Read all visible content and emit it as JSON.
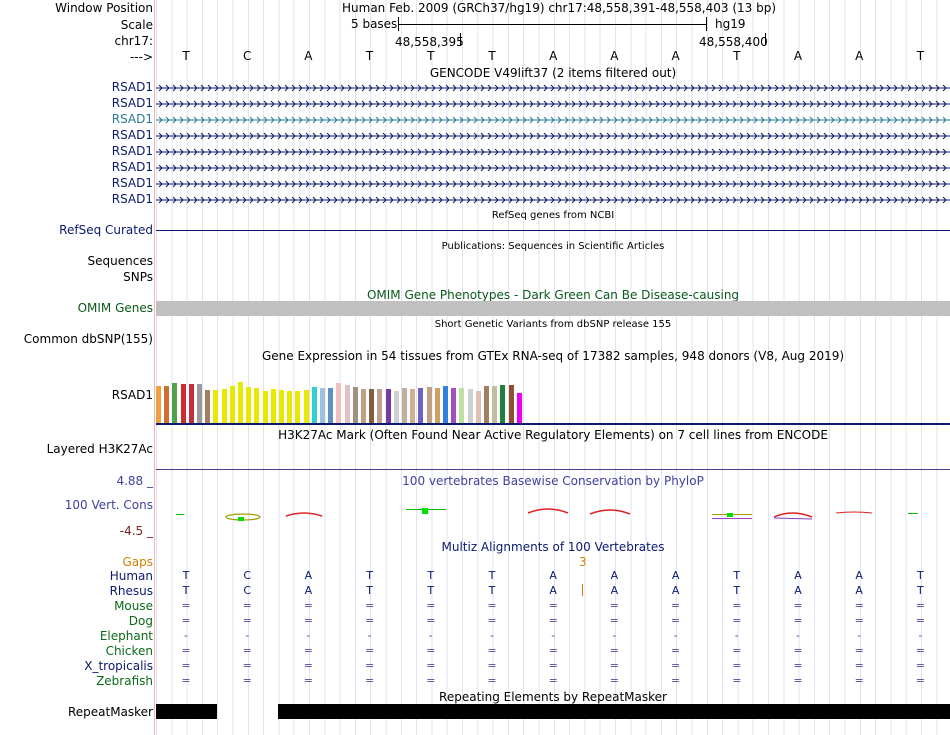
{
  "header": {
    "window_position_label": "Window Position",
    "window_position_value": "Human Feb. 2009 (GRCh37/hg19)   chr17:48,558,391-48,558,403 (13 bp)",
    "scale_label": "Scale",
    "scale_value": "5 bases",
    "assembly": "hg19",
    "chrom_label": "chr17:",
    "pos_left": "48,558,395",
    "pos_right": "48,558,400",
    "strand_label": "--->"
  },
  "bases": [
    "T",
    "C",
    "A",
    "T",
    "T",
    "T",
    "A",
    "A",
    "A",
    "T",
    "A",
    "A",
    "T"
  ],
  "gencode": {
    "title": "GENCODE V49lift37 (2 items filtered out)",
    "genes": [
      "RSAD1",
      "RSAD1",
      "RSAD1",
      "RSAD1",
      "RSAD1",
      "RSAD1",
      "RSAD1",
      "RSAD1"
    ]
  },
  "refseq": {
    "title": "RefSeq genes from NCBI",
    "label": "RefSeq Curated"
  },
  "publications": {
    "title": "Publications: Sequences in Scientific Articles",
    "labels": [
      "Sequences",
      "SNPs"
    ]
  },
  "omim": {
    "title": "OMIM Gene Phenotypes - Dark Green Can Be Disease-causing",
    "label": "OMIM Genes"
  },
  "dbsnp": {
    "title": "Short Genetic Variants from dbSNP release 155",
    "label": "Common dbSNP(155)"
  },
  "gtex": {
    "title": "Gene Expression in 54 tissues from GTEx RNA-seq of 17382 samples, 948 donors (V8, Aug 2019)",
    "label": "RSAD1",
    "tissue_colors": [
      "#f0a040",
      "#d07030",
      "#50a050",
      "#c83030",
      "#c03040",
      "#9a9a9a",
      "#a08060",
      "#e8e800",
      "#e8e800",
      "#e8e800",
      "#e8e800",
      "#e8e800",
      "#e8e800",
      "#e8e800",
      "#e8e800",
      "#e8e800",
      "#e8e800",
      "#e8e800",
      "#e8e800",
      "#30d0d0",
      "#a0c0e0",
      "#6090c0",
      "#f0c0c0",
      "#e0c0c0",
      "#a09080",
      "#c0a080",
      "#806040",
      "#c0a090",
      "#7a3a9a",
      "#d0d0d0",
      "#c0b0a0",
      "#d0b090",
      "#7060c0",
      "#c0a080",
      "#d0a060",
      "#3080e0",
      "#a050c0",
      "#c0e0a0",
      "#d0d0d0",
      "#e0c0b0",
      "#a08060",
      "#c0c0a0",
      "#208040",
      "#905030",
      "#f000f0"
    ],
    "tissue_levels": [
      0.62,
      0.62,
      0.66,
      0.65,
      0.65,
      0.65,
      0.55,
      0.55,
      0.57,
      0.61,
      0.69,
      0.6,
      0.59,
      0.53,
      0.56,
      0.55,
      0.54,
      0.53,
      0.55,
      0.6,
      0.58,
      0.59,
      0.66,
      0.64,
      0.6,
      0.57,
      0.57,
      0.56,
      0.56,
      0.53,
      0.58,
      0.57,
      0.59,
      0.6,
      0.58,
      0.61,
      0.58,
      0.58,
      0.57,
      0.54,
      0.61,
      0.61,
      0.63,
      0.63,
      0.5
    ]
  },
  "h3k27ac": {
    "title": "H3K27Ac Mark (Often Found Near Active Regulatory Elements) on 7 cell lines from ENCODE",
    "label": "Layered H3K27Ac"
  },
  "conservation": {
    "title": "100 vertebrates Basewise Conservation by PhyloP",
    "label": "100 Vert. Cons",
    "max": "4.88 _",
    "min": "-4.5 _"
  },
  "multiz": {
    "title": "Multiz Alignments of 100 Vertebrates",
    "gaps_label": "Gaps",
    "gap_count": "3",
    "species": [
      {
        "name": "Human",
        "row": [
          "T",
          "C",
          "A",
          "T",
          "T",
          "T",
          "A",
          "A",
          "A",
          "T",
          "A",
          "A",
          "T"
        ]
      },
      {
        "name": "Rhesus",
        "row": [
          "T",
          "C",
          "A",
          "T",
          "T",
          "T",
          "A",
          "A",
          "A",
          "T",
          "A",
          "A",
          "T"
        ]
      },
      {
        "name": "Mouse",
        "row": [
          "=",
          "=",
          "=",
          "=",
          "=",
          "=",
          "=",
          "=",
          "=",
          "=",
          "=",
          "=",
          "="
        ]
      },
      {
        "name": "Dog",
        "row": [
          "=",
          "=",
          "=",
          "=",
          "=",
          "=",
          "=",
          "=",
          "=",
          "=",
          "=",
          "=",
          "="
        ]
      },
      {
        "name": "Elephant",
        "row": [
          "-",
          "-",
          "-",
          "-",
          "-",
          "-",
          "-",
          "-",
          "-",
          "-",
          "-",
          "-",
          "-"
        ]
      },
      {
        "name": "Chicken",
        "row": [
          "=",
          "=",
          "=",
          "=",
          "=",
          "=",
          "=",
          "=",
          "=",
          "=",
          "=",
          "=",
          "="
        ]
      },
      {
        "name": "X_tropicalis",
        "row": [
          "=",
          "=",
          "=",
          "=",
          "=",
          "=",
          "=",
          "=",
          "=",
          "=",
          "=",
          "=",
          "="
        ]
      },
      {
        "name": "Zebrafish",
        "row": [
          "=",
          "=",
          "=",
          "=",
          "=",
          "=",
          "=",
          "=",
          "=",
          "=",
          "=",
          "=",
          "="
        ]
      }
    ]
  },
  "repeatmasker": {
    "title": "Repeating Elements by RepeatMasker",
    "label": "RepeatMasker"
  },
  "colors": {
    "navy": "#0a1a6e",
    "teal": "#2a7a9a",
    "omim_gray": "#c0c0c0",
    "cons_label": "#4040a0",
    "cons_min": "#7a2020",
    "gaps": "#d08000"
  }
}
